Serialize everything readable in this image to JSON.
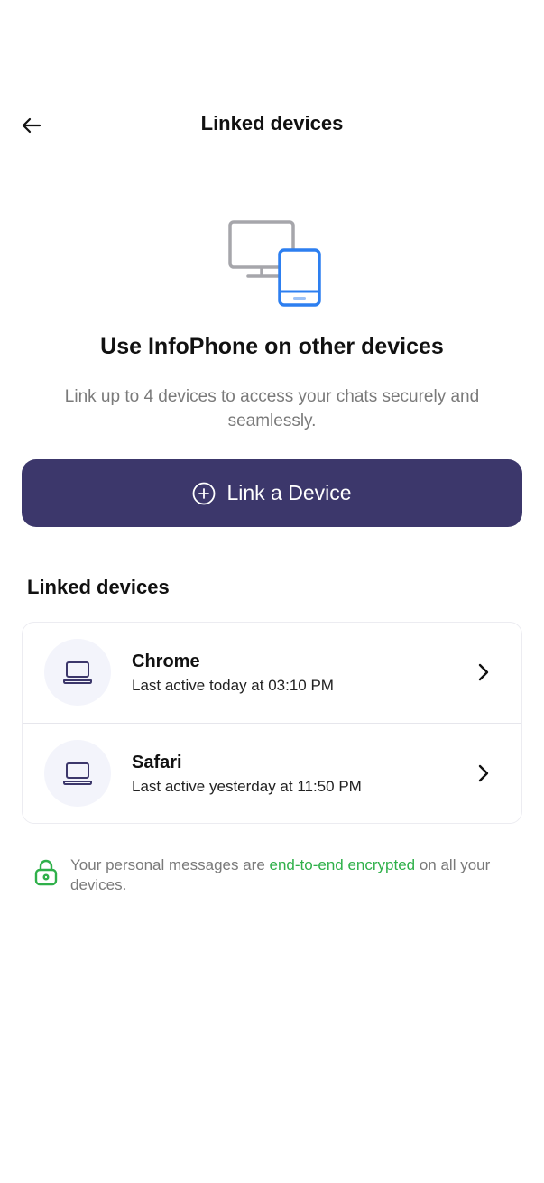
{
  "header": {
    "title": "Linked devices",
    "back_icon": "arrow-left-icon"
  },
  "hero": {
    "icon": "devices-icon",
    "title": "Use InfoPhone on other devices",
    "subtitle": "Link up to 4 devices to access your chats securely and seamlessly."
  },
  "link_button": {
    "icon": "plus-circle-icon",
    "label": "Link a Device",
    "color": "#3c376b"
  },
  "linked_devices": {
    "title": "Linked devices",
    "items": [
      {
        "name": "Chrome",
        "status": "Last active today at 03:10 PM",
        "icon": "laptop-icon"
      },
      {
        "name": "Safari",
        "status": "Last active yesterday at 11:50 PM",
        "icon": "laptop-icon"
      }
    ]
  },
  "encryption": {
    "icon": "lock-icon",
    "before": "Your personal messages are ",
    "link": "end-to-end encrypted",
    "after": " on all your devices.",
    "link_color": "#2fb04a"
  }
}
